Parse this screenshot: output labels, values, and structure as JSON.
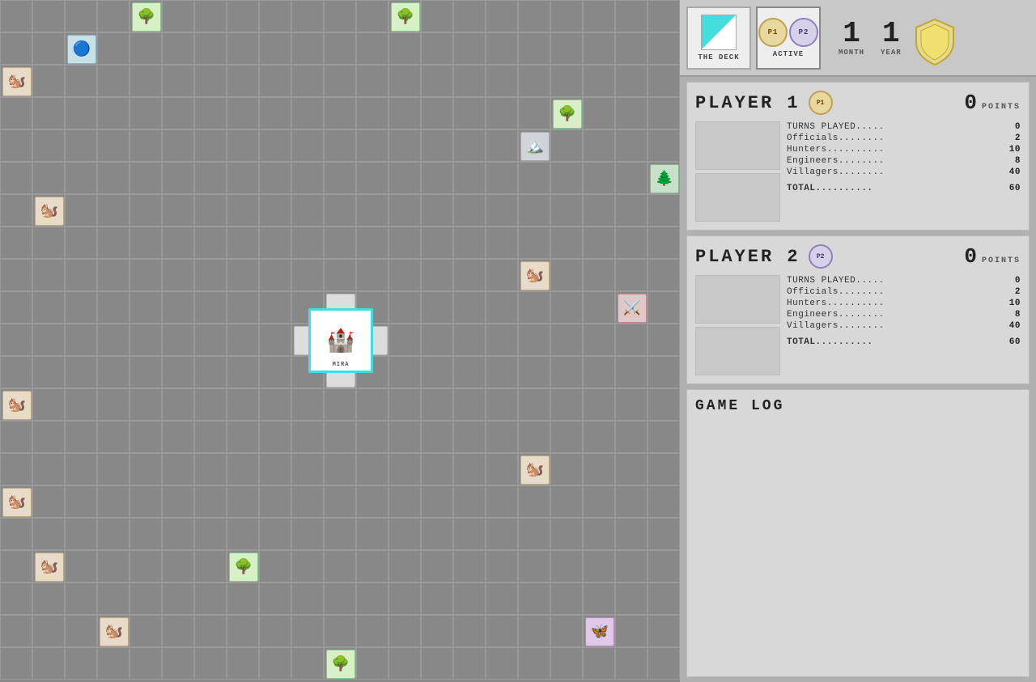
{
  "topbar": {
    "deck_label": "THE DECK",
    "active_label": "ACTIVE",
    "month": "1",
    "year": "1",
    "month_label": "MONTH",
    "year_label": "YEAR",
    "p1_label": "P1",
    "p2_label": "P2"
  },
  "player1": {
    "title": "PLAYER 1",
    "points": "0",
    "points_label": "POINTS",
    "turns_played_label": "TURNS PLAYED.....",
    "turns_played": "0",
    "officials_label": "Officials........",
    "officials": "2",
    "hunters_label": "Hunters..........",
    "hunters": "10",
    "engineers_label": "Engineers........",
    "engineers": "8",
    "villagers_label": "Villagers........",
    "villagers": "40",
    "total_label": "TOTAL..........",
    "total": "60"
  },
  "player2": {
    "title": "PLAYER 2",
    "points": "0",
    "points_label": "POINTS",
    "turns_played_label": "TURNS PLAYED.....",
    "turns_played": "0",
    "officials_label": "Officials........",
    "officials": "2",
    "hunters_label": "Hunters..........",
    "hunters": "10",
    "engineers_label": "Engineers........",
    "engineers": "8",
    "villagers_label": "Villagers........",
    "villagers": "40",
    "total_label": "TOTAL..........",
    "total": "60"
  },
  "gamelog": {
    "title": "GAME  LOG"
  },
  "board": {
    "castle_label": "MIRA"
  }
}
